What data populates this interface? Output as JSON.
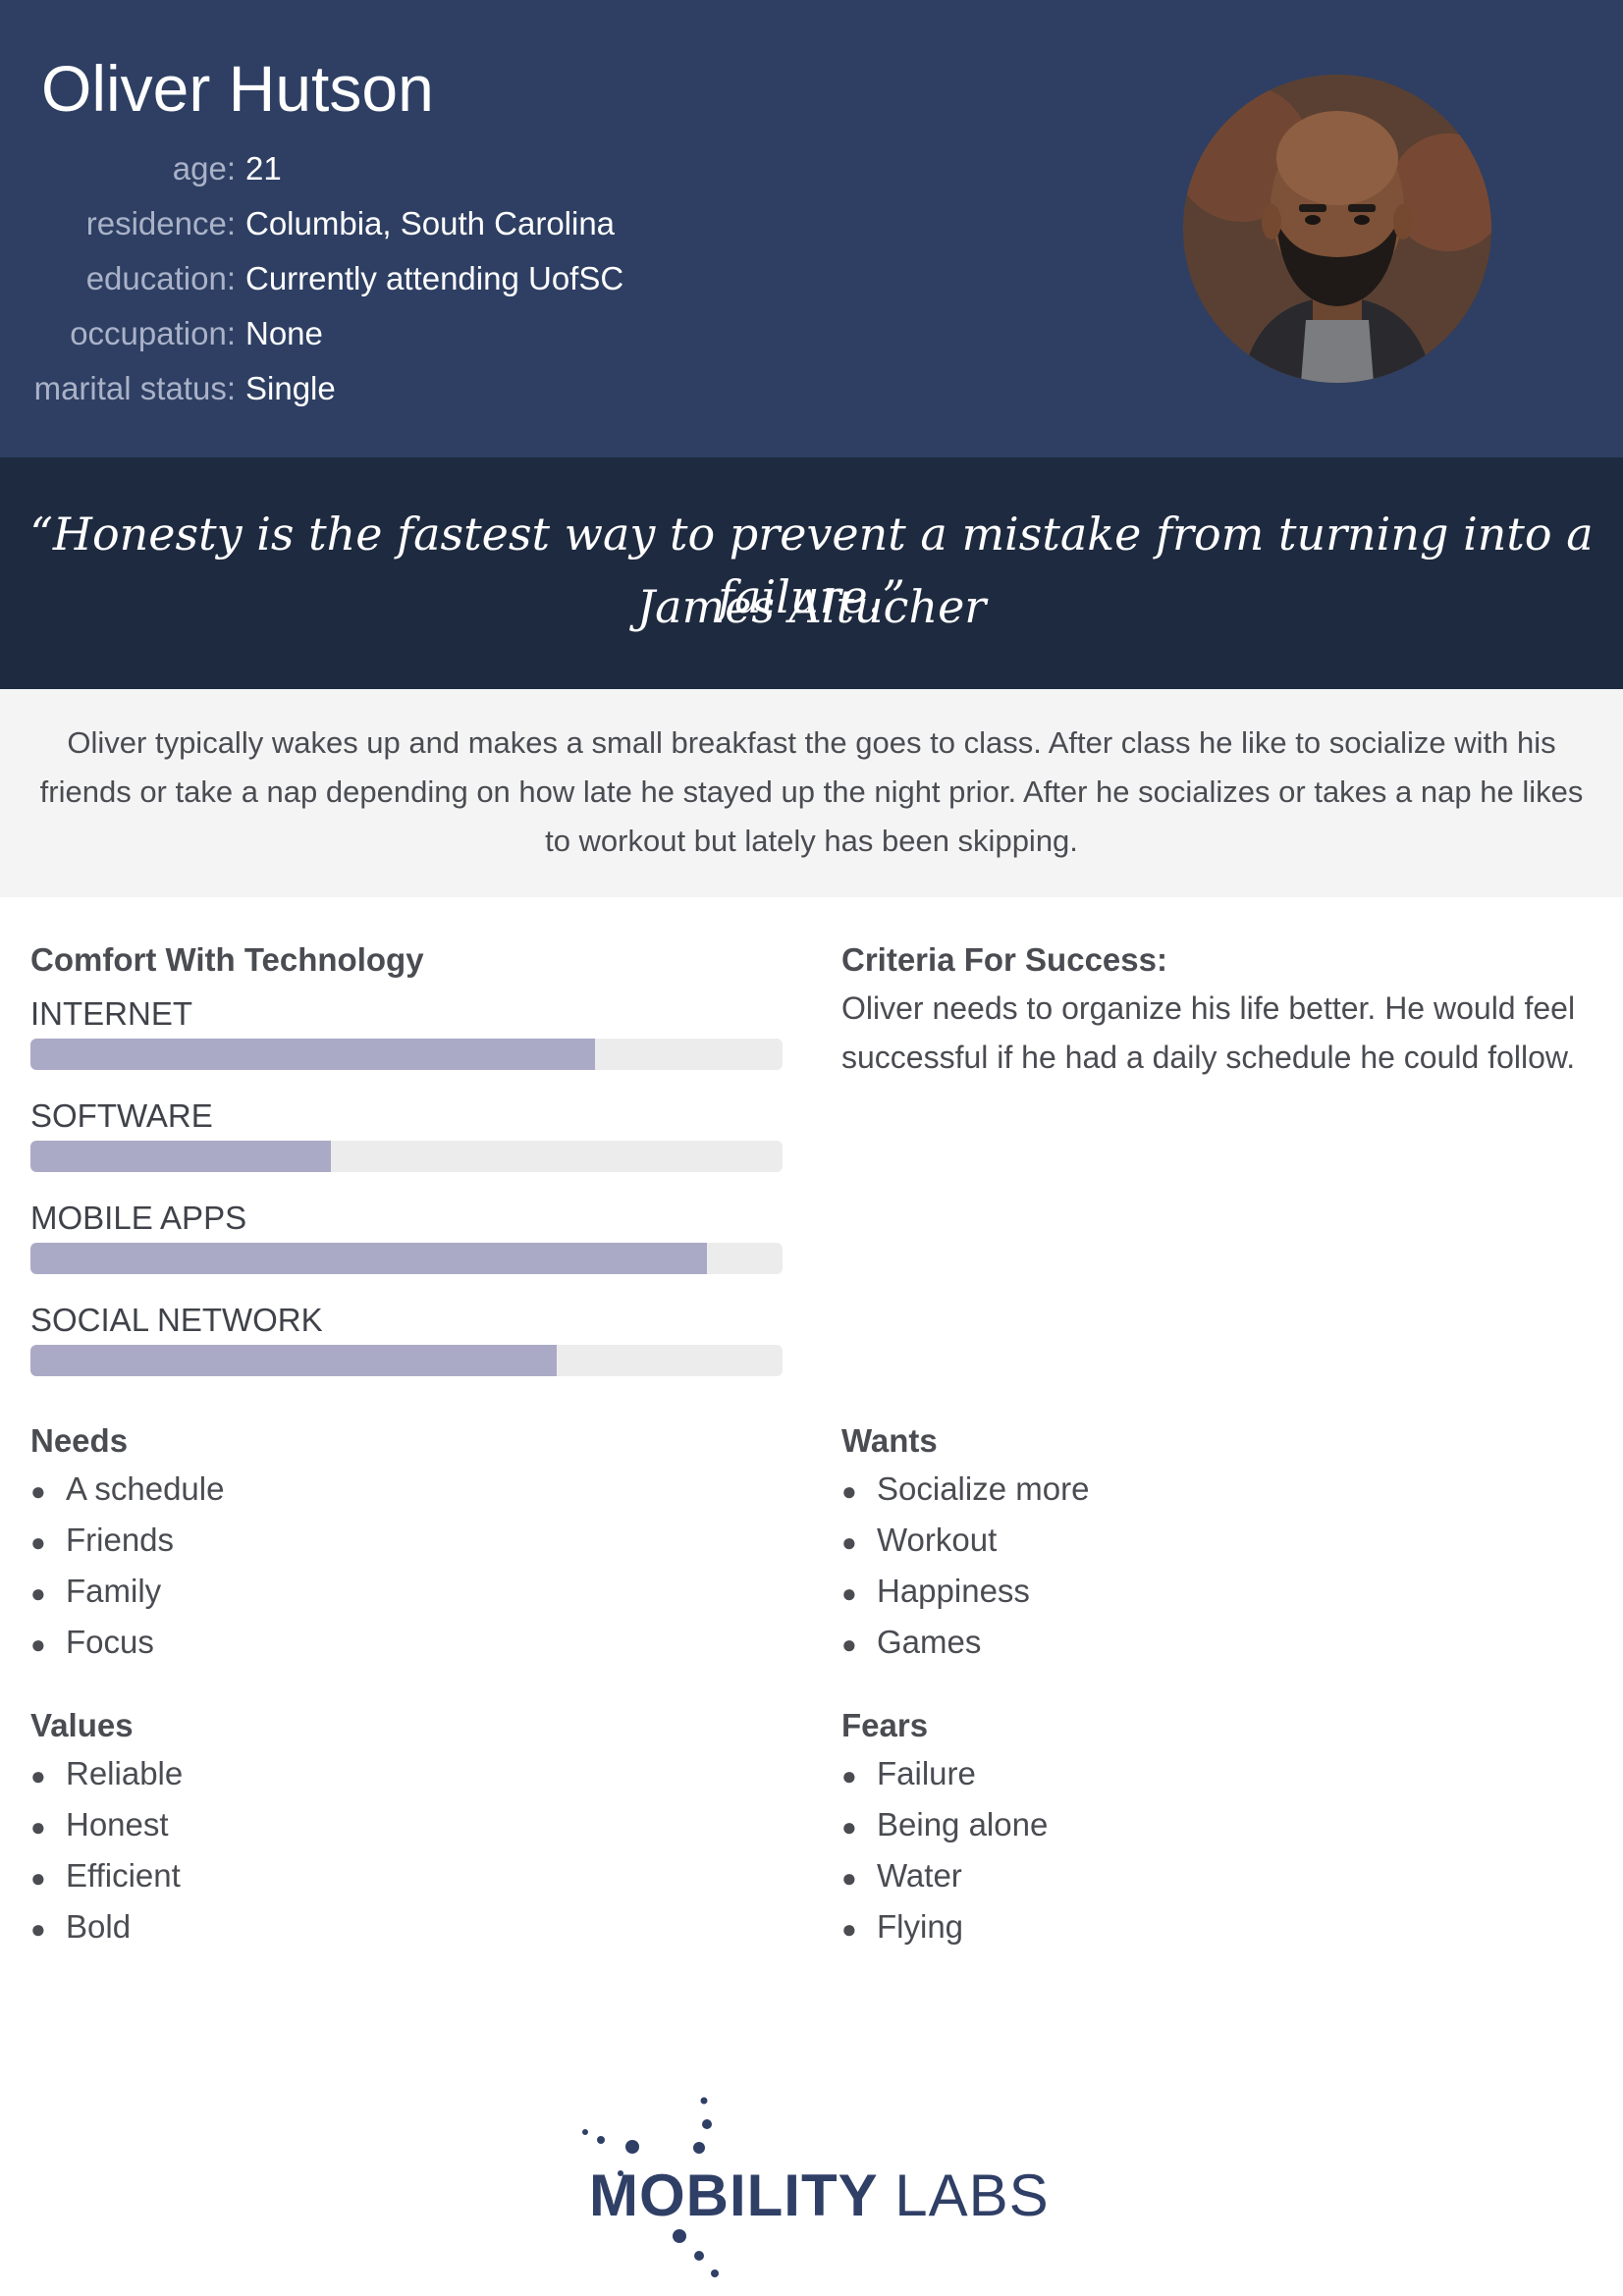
{
  "persona": {
    "name": "Oliver Hutson",
    "facts": [
      {
        "label": "age:",
        "value": "21"
      },
      {
        "label": "residence:",
        "value": "Columbia, South Carolina"
      },
      {
        "label": "education:",
        "value": "Currently attending UofSC"
      },
      {
        "label": "occupation:",
        "value": "None"
      },
      {
        "label": "marital status:",
        "value": "Single"
      }
    ]
  },
  "quote": {
    "text": "“Honesty is the fastest way to prevent a mistake from turning into a failure.”",
    "author": "James Altucher"
  },
  "description": "Oliver typically wakes up and makes a small breakfast the goes to class. After class he like to socialize with his friends or take a nap depending on how late he stayed up the night prior. After he socializes or takes a nap he likes to workout but lately has been skipping.",
  "technology": {
    "heading": "Comfort With Technology",
    "items": [
      {
        "label": "INTERNET",
        "level": 0.75
      },
      {
        "label": "SOFTWARE",
        "level": 0.4
      },
      {
        "label": "MOBILE APPS",
        "level": 0.9
      },
      {
        "label": "SOCIAL NETWORK",
        "level": 0.7
      }
    ]
  },
  "criteria": {
    "heading": "Criteria For Success:",
    "text": "Oliver needs to organize his life better. He would feel successful if he had a daily schedule he could follow."
  },
  "needs": {
    "heading": "Needs",
    "items": [
      "A schedule",
      "Friends",
      "Family",
      "Focus"
    ]
  },
  "wants": {
    "heading": "Wants",
    "items": [
      "Socialize more",
      "Workout",
      "Happiness",
      "Games"
    ]
  },
  "values": {
    "heading": "Values",
    "items": [
      "Reliable",
      "Honest",
      "Efficient",
      "Bold"
    ]
  },
  "fears": {
    "heading": "Fears",
    "items": [
      "Failure",
      "Being alone",
      "Water",
      "Flying"
    ]
  },
  "logo": {
    "part1": "MOBILITY",
    "part2": "LABS"
  },
  "colors": {
    "header_bg": "#2e3f63",
    "quote_bg": "#1e2a3f",
    "bar_fill": "#abaac6",
    "bar_track": "#ececec",
    "logo": "#2f3f66"
  }
}
